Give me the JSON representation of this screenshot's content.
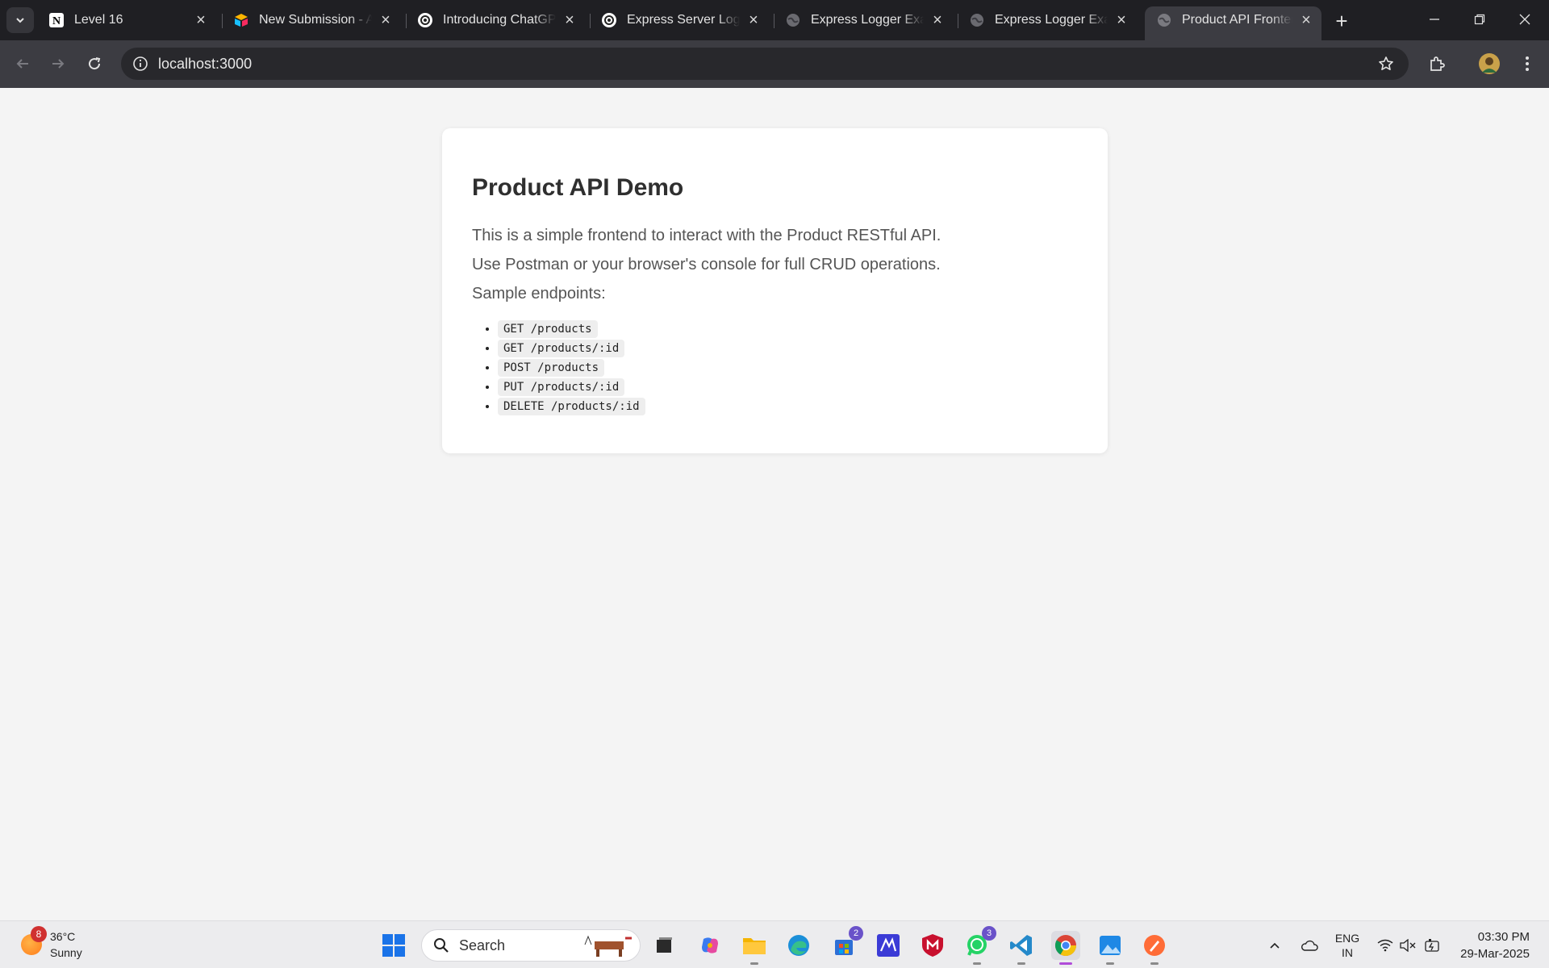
{
  "browser": {
    "tabs": [
      {
        "title": "Level 16",
        "icon": "notion-icon"
      },
      {
        "title": "New Submission - Airtable",
        "icon": "airtable-icon"
      },
      {
        "title": "Introducing ChatGPT",
        "icon": "openai-icon"
      },
      {
        "title": "Express Server Logging",
        "icon": "openai-icon"
      },
      {
        "title": "Express Logger Example",
        "icon": "globe-icon"
      },
      {
        "title": "Express Logger Example",
        "icon": "globe-icon"
      },
      {
        "title": "Product API Frontend",
        "icon": "globe-icon",
        "active": true
      }
    ],
    "url": "localhost:3000"
  },
  "page": {
    "heading": "Product API Demo",
    "paragraphs": [
      "This is a simple frontend to interact with the Product RESTful API.",
      "Use Postman or your browser's console for full CRUD operations.",
      "Sample endpoints:"
    ],
    "endpoints": [
      "GET /products",
      "GET /products/:id",
      "POST /products",
      "PUT /products/:id",
      "DELETE /products/:id"
    ]
  },
  "taskbar": {
    "weather": {
      "temp": "36°C",
      "condition": "Sunny",
      "badge": "8"
    },
    "search_label": "Search",
    "store_badge": "2",
    "whatsapp_badge": "3",
    "language_line1": "ENG",
    "language_line2": "IN",
    "time": "03:30 PM",
    "date": "29-Mar-2025"
  },
  "colors": {
    "chrome_dark": "#1f1f23",
    "toolbar": "#3c3c42",
    "page_bg": "#f4f4f4",
    "card_bg": "#ffffff"
  }
}
